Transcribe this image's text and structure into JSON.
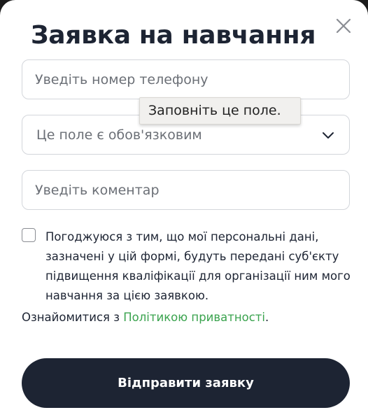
{
  "form": {
    "title": "Заявка на навчання",
    "phone_placeholder": "Уведіть номер телефону",
    "select_placeholder": "Це поле є обов'язковим",
    "comment_placeholder": "Уведіть коментар",
    "consent_text": "Погоджуюся з тим, що мої персональні дані, зазначені у цій формі, будуть передані суб'єкту підвищення кваліфікації для організації ним мого навчання за цією заявкою.",
    "privacy_prefix": "Ознайомитися з ",
    "privacy_link": "Політикою приватності",
    "privacy_suffix": ".",
    "submit_label": "Відправити заявку",
    "consent_checked": false
  },
  "tooltip": {
    "text": "Заповніть це поле."
  },
  "colors": {
    "dark": "#1d2433",
    "link": "#3aa34e",
    "border": "#d3d6db",
    "placeholder": "#6b6f76"
  },
  "icons": {
    "close": "close-icon",
    "select": "chevron-down-icon"
  }
}
